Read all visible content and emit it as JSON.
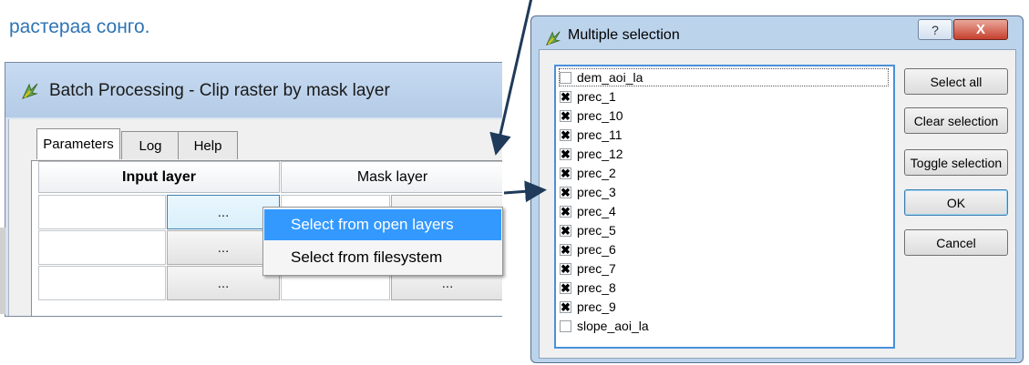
{
  "caption": "растераа сонго.",
  "batch_window": {
    "title": "Batch Processing - Clip raster by mask layer",
    "tabs": [
      "Parameters",
      "Log",
      "Help"
    ],
    "columns": [
      "Input layer",
      "Mask layer"
    ],
    "browse_label": "..."
  },
  "context_menu": {
    "items": [
      "Select from open layers",
      "Select from filesystem"
    ]
  },
  "dialog": {
    "title": "Multiple selection",
    "help_label": "?",
    "close_label": "X",
    "items": [
      {
        "label": "dem_aoi_la",
        "checked": false
      },
      {
        "label": "prec_1",
        "checked": true
      },
      {
        "label": "prec_10",
        "checked": true
      },
      {
        "label": "prec_11",
        "checked": true
      },
      {
        "label": "prec_12",
        "checked": true
      },
      {
        "label": "prec_2",
        "checked": true
      },
      {
        "label": "prec_3",
        "checked": true
      },
      {
        "label": "prec_4",
        "checked": true
      },
      {
        "label": "prec_5",
        "checked": true
      },
      {
        "label": "prec_6",
        "checked": true
      },
      {
        "label": "prec_7",
        "checked": true
      },
      {
        "label": "prec_8",
        "checked": true
      },
      {
        "label": "prec_9",
        "checked": true
      },
      {
        "label": "slope_aoi_la",
        "checked": false
      }
    ],
    "buttons": {
      "select_all": "Select all",
      "clear_selection": "Clear selection",
      "toggle_selection": "Toggle selection",
      "ok": "OK",
      "cancel": "Cancel"
    }
  },
  "colors": {
    "caption": "#2e74b5",
    "highlight": "#3399ff",
    "arrow": "#1f3a5a"
  }
}
